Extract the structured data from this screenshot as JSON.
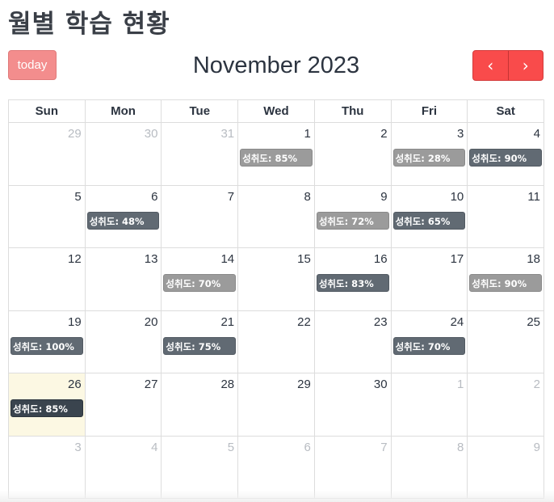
{
  "page": {
    "title": "월별 학습 현황"
  },
  "toolbar": {
    "today_label": "today",
    "month_title": "November 2023",
    "prev_symbol": "‹",
    "next_symbol": "›"
  },
  "colors": {
    "accent": "#f94b4b",
    "today_button": "#f38d8d",
    "today_highlight": "#fcf8e3",
    "event_light": "#9b9b9b",
    "event_mid": "#616a73",
    "event_dark": "#3a444e"
  },
  "weekdays": [
    "Sun",
    "Mon",
    "Tue",
    "Wed",
    "Thu",
    "Fri",
    "Sat"
  ],
  "weeks": [
    [
      {
        "day": "29",
        "other": true
      },
      {
        "day": "30",
        "other": true
      },
      {
        "day": "31",
        "other": true
      },
      {
        "day": "1",
        "event": {
          "label": "성취도: 85%",
          "tone": "light"
        }
      },
      {
        "day": "2"
      },
      {
        "day": "3",
        "event": {
          "label": "성취도: 28%",
          "tone": "light"
        }
      },
      {
        "day": "4",
        "event": {
          "label": "성취도: 90%",
          "tone": "mid"
        }
      }
    ],
    [
      {
        "day": "5"
      },
      {
        "day": "6",
        "event": {
          "label": "성취도: 48%",
          "tone": "mid"
        }
      },
      {
        "day": "7"
      },
      {
        "day": "8"
      },
      {
        "day": "9",
        "event": {
          "label": "성취도: 72%",
          "tone": "light"
        }
      },
      {
        "day": "10",
        "event": {
          "label": "성취도: 65%",
          "tone": "mid"
        }
      },
      {
        "day": "11"
      }
    ],
    [
      {
        "day": "12"
      },
      {
        "day": "13"
      },
      {
        "day": "14",
        "event": {
          "label": "성취도: 70%",
          "tone": "light"
        }
      },
      {
        "day": "15"
      },
      {
        "day": "16",
        "event": {
          "label": "성취도: 83%",
          "tone": "mid"
        }
      },
      {
        "day": "17"
      },
      {
        "day": "18",
        "event": {
          "label": "성취도: 90%",
          "tone": "light"
        }
      }
    ],
    [
      {
        "day": "19",
        "event": {
          "label": "성취도: 100%",
          "tone": "mid"
        }
      },
      {
        "day": "20"
      },
      {
        "day": "21",
        "event": {
          "label": "성취도: 75%",
          "tone": "mid"
        }
      },
      {
        "day": "22"
      },
      {
        "day": "23"
      },
      {
        "day": "24",
        "event": {
          "label": "성취도: 70%",
          "tone": "mid"
        }
      },
      {
        "day": "25"
      }
    ],
    [
      {
        "day": "26",
        "today": true,
        "event": {
          "label": "성취도: 85%",
          "tone": "dark"
        }
      },
      {
        "day": "27"
      },
      {
        "day": "28"
      },
      {
        "day": "29"
      },
      {
        "day": "30"
      },
      {
        "day": "1",
        "other": true
      },
      {
        "day": "2",
        "other": true
      }
    ],
    [
      {
        "day": "3",
        "other": true
      },
      {
        "day": "4",
        "other": true
      },
      {
        "day": "5",
        "other": true
      },
      {
        "day": "6",
        "other": true
      },
      {
        "day": "7",
        "other": true
      },
      {
        "day": "8",
        "other": true
      },
      {
        "day": "9",
        "other": true
      }
    ]
  ]
}
